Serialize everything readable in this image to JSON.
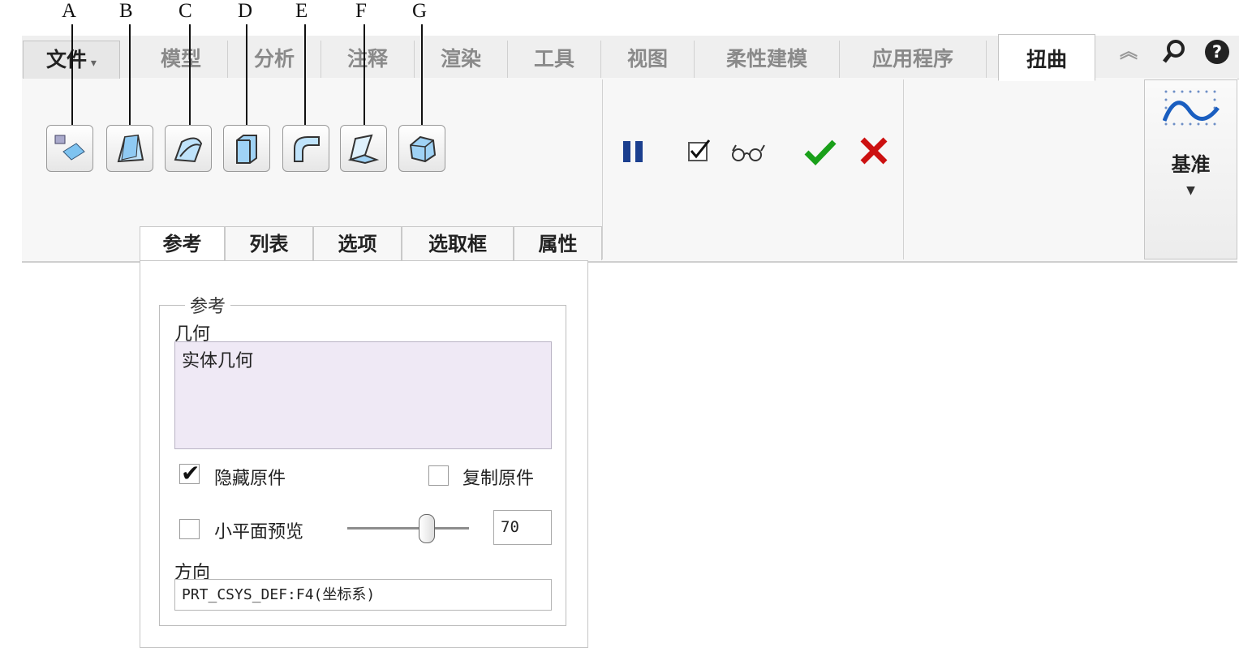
{
  "callouts": [
    "A",
    "B",
    "C",
    "D",
    "E",
    "F",
    "G"
  ],
  "menu": {
    "file_label": "文件",
    "tabs": [
      "模型",
      "分析",
      "注释",
      "渲染",
      "工具",
      "视图",
      "柔性建模",
      "应用程序"
    ],
    "active_tab": "扭曲"
  },
  "ribbon": {
    "tool_buttons": [
      {
        "callout": "A",
        "icon": "transform-icon"
      },
      {
        "callout": "B",
        "icon": "warp-icon"
      },
      {
        "callout": "C",
        "icon": "spine-icon"
      },
      {
        "callout": "D",
        "icon": "stretch-icon"
      },
      {
        "callout": "E",
        "icon": "bend-icon"
      },
      {
        "callout": "F",
        "icon": "twist-icon"
      },
      {
        "callout": "G",
        "icon": "sculpt-icon"
      }
    ],
    "datum_label": "基准",
    "actions": {
      "pause": "pause-icon",
      "preview": "preview-icon",
      "ok": "confirm-icon",
      "cancel": "cancel-icon"
    },
    "colors": {
      "ok": "#1aa01a",
      "cancel": "#cc1111",
      "pause": "#1b3f8f"
    }
  },
  "panel_tabs": [
    "参考",
    "列表",
    "选项",
    "选取框",
    "属性"
  ],
  "references": {
    "group_title": "参考",
    "geometry_label": "几何",
    "geometry_value": "实体几何",
    "hide_original": {
      "label": "隐藏原件",
      "checked": true
    },
    "copy_original": {
      "label": "复制原件",
      "checked": false
    },
    "facet_preview": {
      "label": "小平面预览",
      "checked": false,
      "value": "70"
    },
    "direction_label": "方向",
    "direction_value": "PRT_CSYS_DEF:F4(坐标系)"
  }
}
